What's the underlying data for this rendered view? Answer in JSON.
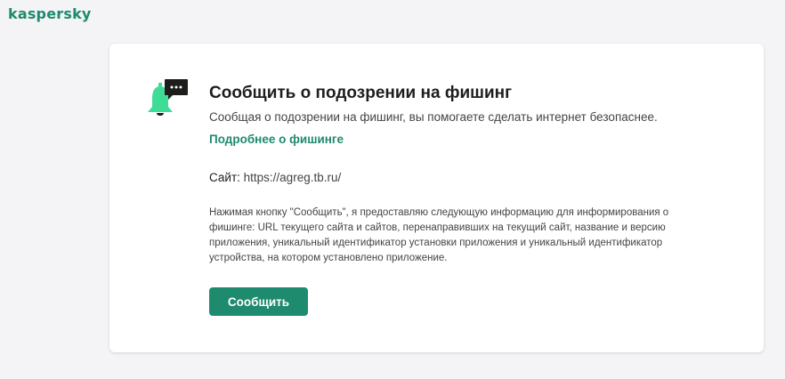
{
  "brand": {
    "logo_text": "kaspersky",
    "accent_color": "#1e8a6e"
  },
  "report": {
    "icon": "phishing-bell-icon",
    "title": "Сообщить о подозрении на фишинг",
    "subtitle": "Сообщая о подозрении на фишинг, вы помогаете сделать интернет безопаснее.",
    "learn_more_label": "Подробнее о фишинге",
    "site_label": "Сайт:",
    "site_url": "https://agreg.tb.ru/",
    "disclaimer": "Нажимая кнопку \"Сообщить\", я предоставляю следующую информацию для информирования о фишинге: URL текущего сайта и сайтов, перенаправивших на текущий сайт, название и версию приложения, уникальный идентификатор установки приложения и уникальный идентификатор устройства, на котором установлено приложение.",
    "submit_label": "Сообщить"
  }
}
